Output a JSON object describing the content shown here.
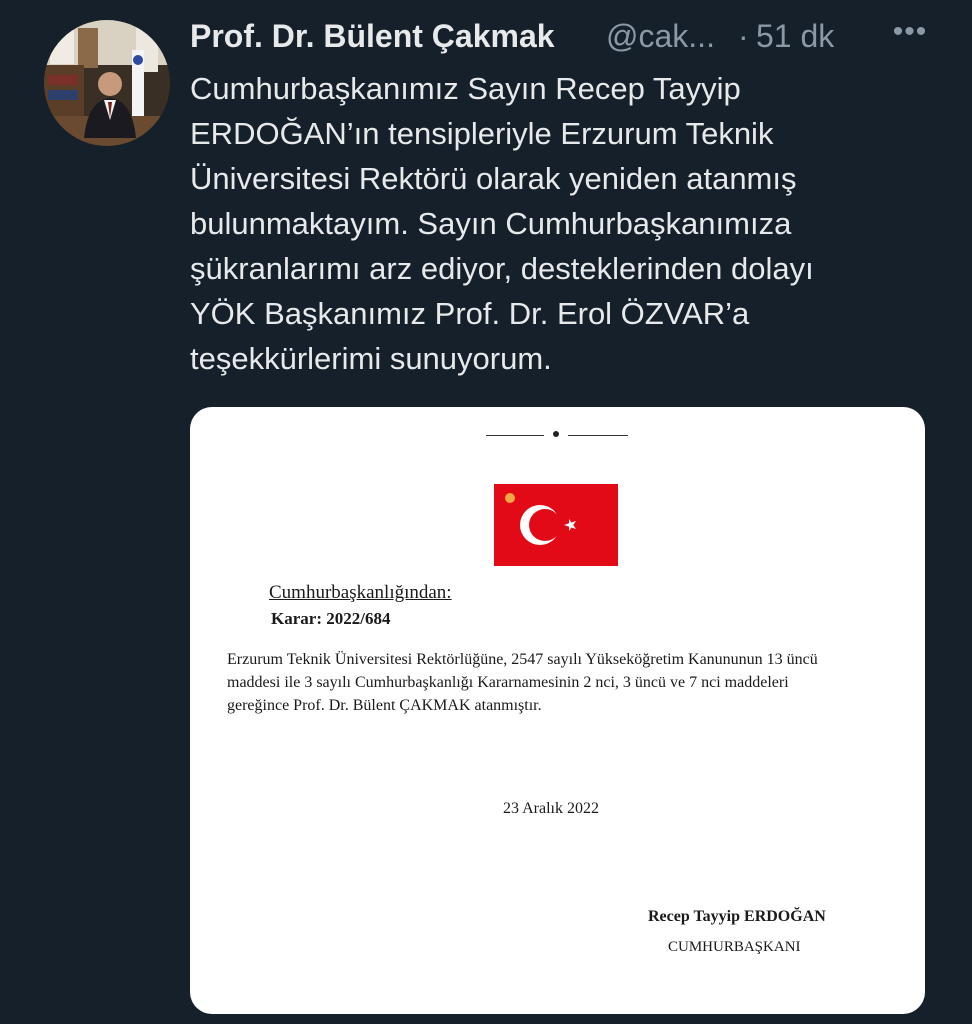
{
  "tweet": {
    "author": {
      "display_name": "Prof. Dr. Bülent Çakmak",
      "handle": "@cak...",
      "avatar": "profile-photo"
    },
    "separator": "·",
    "time_ago": "51 dk",
    "more_icon": "more-horizontal-icon",
    "text_lines": [
      "Cumhurbaşkanımız Sayın Recep Tayyip",
      "ERDOĞAN’ın tensipleriyle Erzurum Teknik",
      "Üniversitesi Rektörü olarak yeniden atanmış",
      "bulunmaktayım. Sayın Cumhurbaşkanımıza",
      "şükranlarımı arz ediyor, desteklerinden dolayı",
      "YÖK Başkanımız Prof. Dr. Erol ÖZVAR’a",
      "teşekkürlerimi sunuyorum."
    ]
  },
  "media": {
    "flag": "turkish-flag",
    "issuer": "Cumhurbaşkanlığından:",
    "decision": "Karar: 2022/684",
    "body_lines": [
      "Erzurum Teknik Üniversitesi Rektörlüğüne, 2547 sayılı Yükseköğretim Kanununun 13 üncü",
      "maddesi ile 3 sayılı Cumhurbaşkanlığı Kararnamesinin 2 nci, 3 üncü ve 7 nci maddeleri",
      "gereğince Prof. Dr. Bülent ÇAKMAK atanmıştır."
    ],
    "date": "23 Aralık 2022",
    "signer": "Recep Tayyip ERDOĞAN",
    "signer_title": "CUMHURBAŞKANI"
  },
  "colors": {
    "background": "#15202b",
    "primary_text": "#e7e9ea",
    "secondary_text": "#8b98a5",
    "flag_red": "#e30a17"
  }
}
